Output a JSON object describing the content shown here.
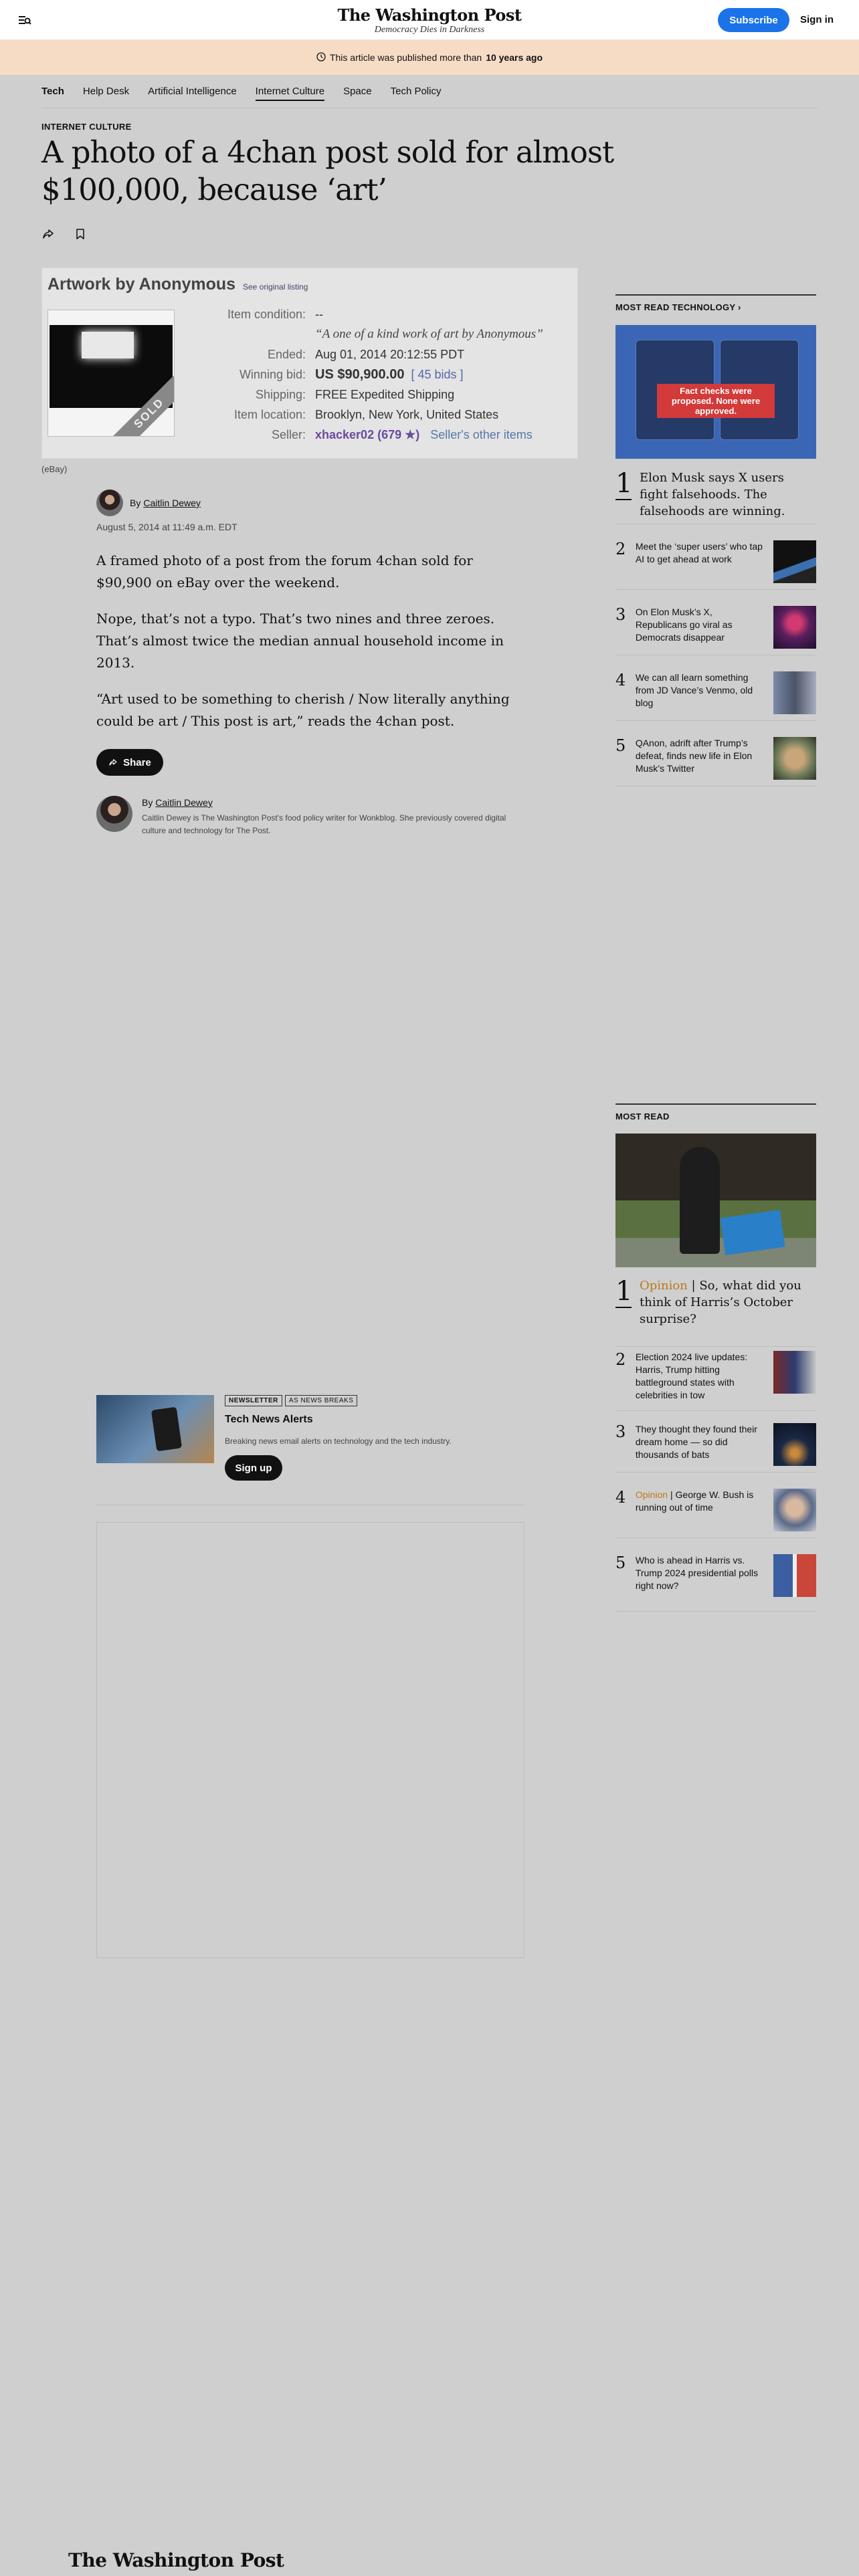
{
  "header": {
    "logo": "The Washington Post",
    "tagline": "Democracy Dies in Darkness",
    "subscribe": "Subscribe",
    "signin": "Sign in"
  },
  "notice": {
    "prefix": "This article was published more than",
    "bold": "10 years ago"
  },
  "nav": {
    "home": "Tech",
    "items": [
      "Help Desk",
      "Artificial Intelligence",
      "Internet Culture",
      "Space",
      "Tech Policy"
    ]
  },
  "article": {
    "kicker": "INTERNET CULTURE",
    "headline": "A photo of a 4chan post sold for almost $100,000, because ‘art’",
    "image": {
      "title": "Artwork by Anonymous",
      "orig_link": "See original listing",
      "sold": "SOLD",
      "specs": [
        {
          "label": "Item condition:",
          "value": "--"
        },
        {
          "label": "",
          "value": "“A one of a kind work of art by Anonymous”"
        },
        {
          "label": "Ended:",
          "value": "Aug 01, 2014   20:12:55 PDT"
        },
        {
          "label": "Winning bid:",
          "value": "US $90,900.00"
        },
        {
          "label": "Shipping:",
          "value": "FREE   Expedited Shipping"
        },
        {
          "label": "Item location:",
          "value": "Brooklyn, New York, United States"
        },
        {
          "label": "Seller:",
          "value": "xhacker02 (679 ★)"
        }
      ],
      "bids": "[ 45 bids ]",
      "other_items": "Seller's other items",
      "caption": "(eBay)"
    },
    "byline_prefix": "By",
    "author": "Caitlin Dewey",
    "date": "August 5, 2014 at 11:49 a.m. EDT",
    "paragraphs": [
      "A framed photo of a post from the forum 4chan sold for $90,900 on eBay over the weekend.",
      "Nope, that’s not a typo. That’s two nines and three zeroes. That’s almost twice the median annual household income in 2013.",
      "“Art used to be something to cherish / Now literally anything could be art / This post is art,” reads the 4chan post."
    ],
    "share": "Share",
    "bio": "Caitlin Dewey is The Washington Post's food policy writer for Wonkblog. She previously covered digital culture and technology for The Post."
  },
  "newsletter": {
    "badge": "NEWSLETTER",
    "badge2": "AS NEWS BREAKS",
    "title": "Tech News Alerts",
    "desc": "Breaking news email alerts on technology and the tech industry.",
    "button": "Sign up"
  },
  "sidebar": {
    "tech_head": "MOST READ TECHNOLOGY ›",
    "tech_hero_tag": "Fact checks were proposed. None were approved.",
    "tech_items": [
      {
        "num": "1",
        "text": "Elon Musk says X users fight falsehoods. The falsehoods are winning."
      },
      {
        "num": "2",
        "text": "Meet the ‘super users’ who tap AI to get ahead at work"
      },
      {
        "num": "3",
        "text": "On Elon Musk’s X, Republicans go viral as Democrats disappear"
      },
      {
        "num": "4",
        "text": "We can all learn something from JD Vance’s Venmo, old blog"
      },
      {
        "num": "5",
        "text": "QAnon, adrift after Trump’s defeat, finds new life in Elon Musk’s Twitter"
      }
    ],
    "most_head": "MOST READ",
    "most_items": [
      {
        "num": "1",
        "label": "Opinion",
        "text": "So, what did you think of Harris’s October surprise?"
      },
      {
        "num": "2",
        "label": "",
        "text": "Election 2024 live updates: Harris, Trump hitting battleground states with celebrities in tow"
      },
      {
        "num": "3",
        "label": "",
        "text": "They thought they found their dream home — so did thousands of bats"
      },
      {
        "num": "4",
        "label": "Opinion",
        "text": "George W. Bush is running out of time"
      },
      {
        "num": "5",
        "label": "",
        "text": "Who is ahead in Harris vs. Trump 2024 presidential polls right now?"
      }
    ]
  },
  "footer": {
    "logo": "The Washington Post"
  },
  "colors": {
    "accent": "#1a73e8",
    "notice": "#f7dcc5",
    "opinion": "#b9791c"
  }
}
